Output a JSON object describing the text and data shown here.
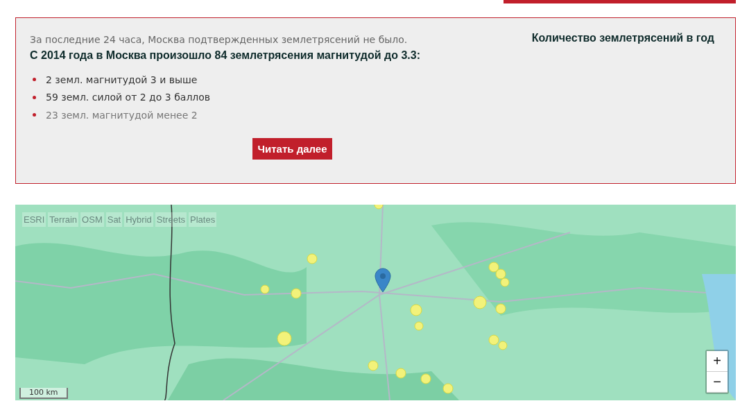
{
  "summary": {
    "last_24h": "За последние 24 часа, Москва подтвержденных землетрясений не было.",
    "headline": "С 2014 года в Москва произошло 84 землетрясения магнитудой до 3.3:",
    "items": [
      {
        "text": "2 земл. магнитудой 3 и выше",
        "kind": "normal"
      },
      {
        "text": "59 земл. силой от 2 до 3 баллов",
        "kind": "normal"
      },
      {
        "text": "23 земл. магнитудой менее 2",
        "kind": "muted"
      }
    ],
    "button": "Читать далее",
    "chart_title": "Количество землетрясений в год"
  },
  "map": {
    "layers": [
      "ESRI",
      "Terrain",
      "OSM",
      "Sat",
      "Hybrid",
      "Streets",
      "Plates"
    ],
    "zoom_in": "+",
    "zoom_out": "−",
    "scale": "100 km"
  }
}
